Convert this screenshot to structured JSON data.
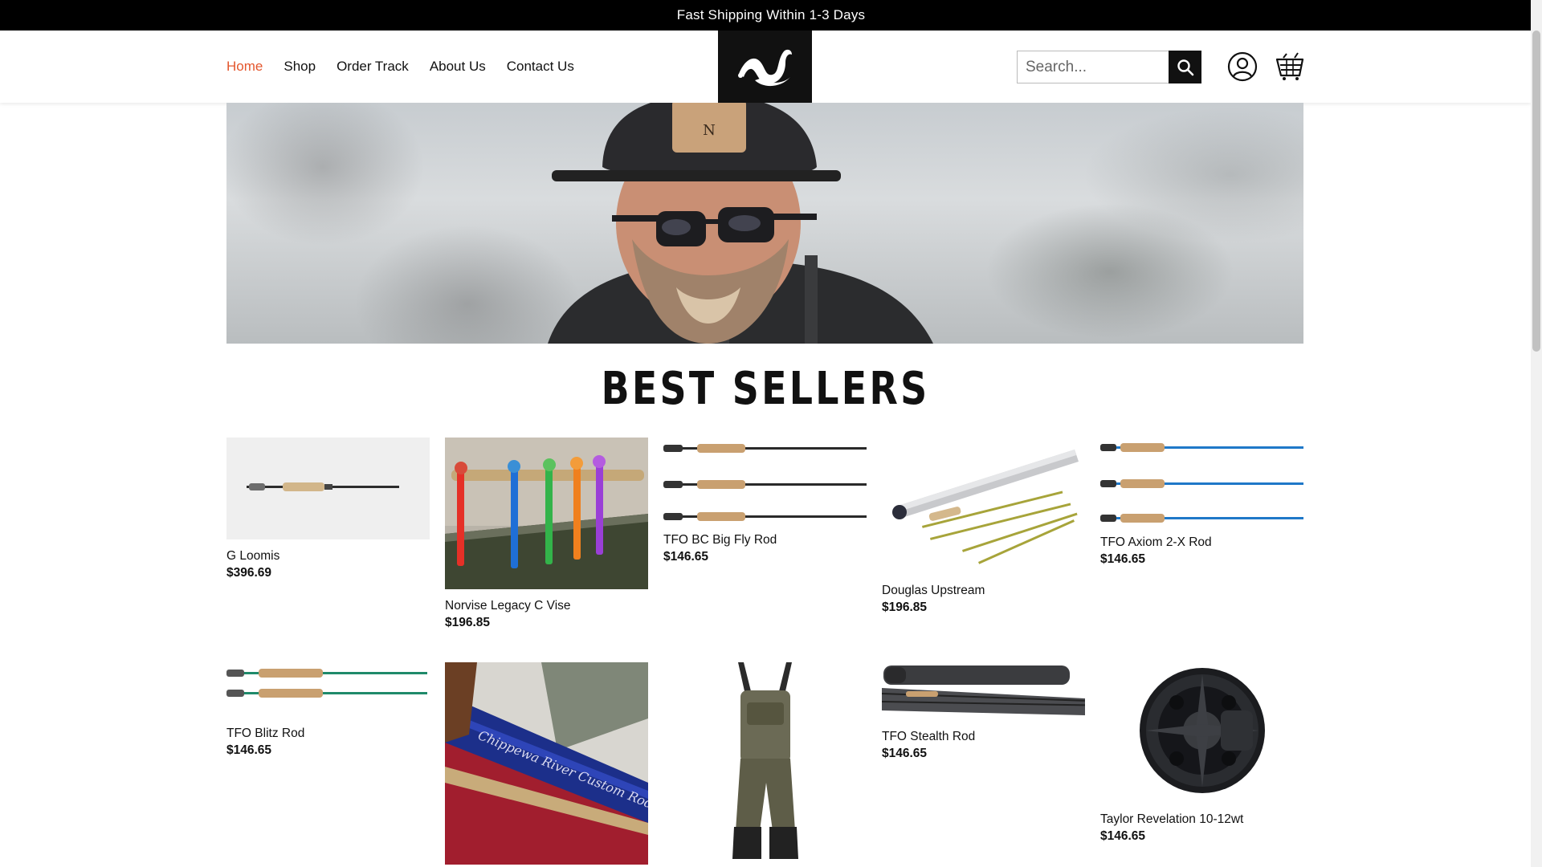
{
  "announcement": "Fast Shipping Within 1-3 Days",
  "nav": {
    "items": [
      {
        "label": "Home",
        "active": true
      },
      {
        "label": "Shop",
        "active": false
      },
      {
        "label": "Order Track",
        "active": false
      },
      {
        "label": "About Us",
        "active": false
      },
      {
        "label": "Contact Us",
        "active": false
      }
    ]
  },
  "search": {
    "placeholder": "Search...",
    "value": ""
  },
  "icons": {
    "logo": "natives-logo",
    "search": "search-icon",
    "account": "user-icon",
    "cart": "cart-icon"
  },
  "colors": {
    "accent": "#e4572e",
    "dark": "#111111"
  },
  "section_title": "BEST SELLERS",
  "products": [
    {
      "name": "G Loomis",
      "price": "$396.69"
    },
    {
      "name": "Norvise Legacy C Vise",
      "price": "$196.85"
    },
    {
      "name": "TFO BC Big Fly Rod",
      "price": "$146.65"
    },
    {
      "name": "Douglas Upstream",
      "price": "$196.85"
    },
    {
      "name": "TFO Axiom 2-X Rod",
      "price": "$146.65"
    },
    {
      "name": "TFO Blitz Rod",
      "price": "$146.65"
    },
    {
      "name": "",
      "price": ""
    },
    {
      "name": "",
      "price": ""
    },
    {
      "name": "TFO Stealth Rod",
      "price": "$146.65"
    },
    {
      "name": "Taylor Revelation 10-12wt",
      "price": "$146.65"
    }
  ]
}
